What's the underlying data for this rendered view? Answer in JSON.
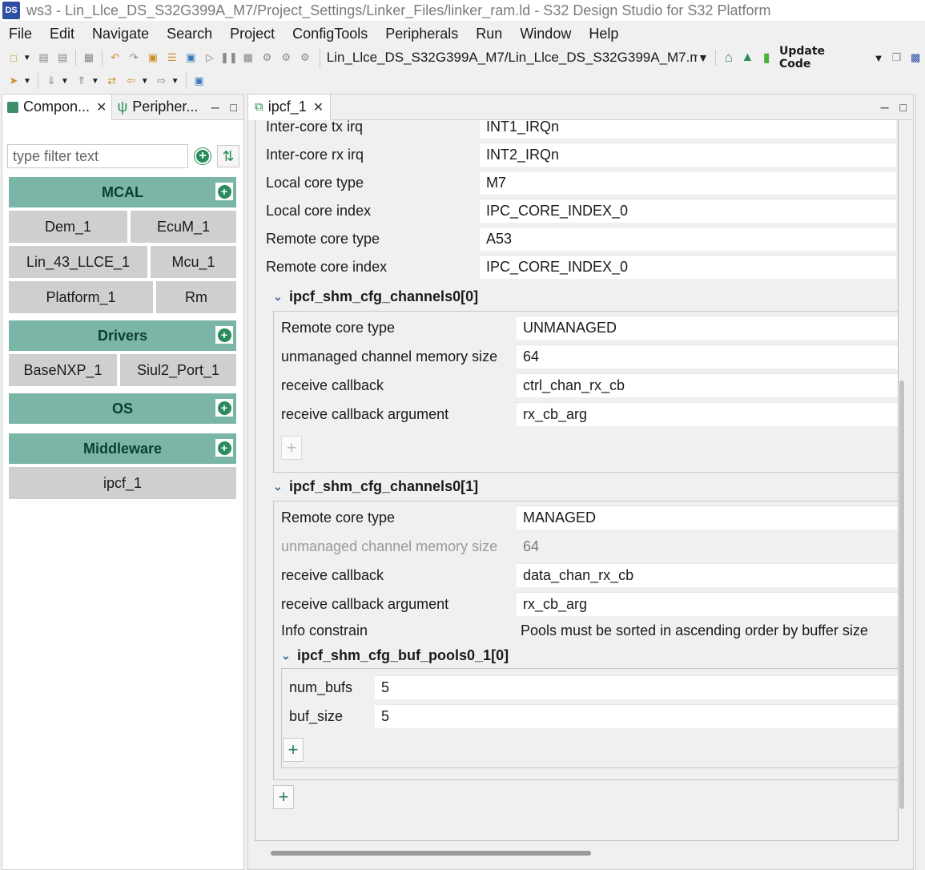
{
  "window": {
    "title": "ws3 - Lin_Llce_DS_S32G399A_M7/Project_Settings/Linker_Files/linker_ram.ld - S32 Design Studio for S32 Platform"
  },
  "menu": [
    "File",
    "Edit",
    "Navigate",
    "Search",
    "Project",
    "ConfigTools",
    "Peripherals",
    "Run",
    "Window",
    "Help"
  ],
  "toolbar": {
    "path": "Lin_Llce_DS_S32G399A_M7/Lin_Llce_DS_S32G399A_M7.m",
    "update_code": "Update Code"
  },
  "left": {
    "tab1": "Compon...",
    "tab2": "Peripher...",
    "filter_placeholder": "type filter text",
    "categories": {
      "mcal": {
        "name": "MCAL",
        "items": [
          "Dem_1",
          "EcuM_1",
          "Lin_43_LLCE_1",
          "Mcu_1",
          "Platform_1",
          "Rm"
        ]
      },
      "drivers": {
        "name": "Drivers",
        "items": [
          "BaseNXP_1",
          "Siul2_Port_1"
        ]
      },
      "os": {
        "name": "OS"
      },
      "middleware": {
        "name": "Middleware",
        "items": [
          "ipcf_1"
        ]
      }
    }
  },
  "editor": {
    "tab": "ipcf_1",
    "top_rows": [
      {
        "label": "Inter-core tx irq",
        "value": "INT1_IRQn"
      },
      {
        "label": "Inter-core rx irq",
        "value": "INT2_IRQn"
      },
      {
        "label": "Local core type",
        "value": "M7"
      },
      {
        "label": "Local core index",
        "value": "IPC_CORE_INDEX_0"
      },
      {
        "label": "Remote core type",
        "value": "A53"
      },
      {
        "label": "Remote core index",
        "value": "IPC_CORE_INDEX_0"
      }
    ],
    "ch0": {
      "title": "ipcf_shm_cfg_channels0[0]",
      "rows": [
        {
          "label": "Remote core type",
          "value": "UNMANAGED"
        },
        {
          "label": "unmanaged channel memory size",
          "value": "64"
        },
        {
          "label": "receive callback",
          "value": "ctrl_chan_rx_cb"
        },
        {
          "label": "receive callback argument",
          "value": "rx_cb_arg"
        }
      ]
    },
    "ch1": {
      "title": "ipcf_shm_cfg_channels0[1]",
      "rows": [
        {
          "label": "Remote core type",
          "value": "MANAGED"
        },
        {
          "label": "unmanaged channel memory size",
          "value": "64"
        },
        {
          "label": "receive callback",
          "value": "data_chan_rx_cb"
        },
        {
          "label": "receive callback argument",
          "value": "rx_cb_arg"
        }
      ],
      "info_label": "Info constrain",
      "info_value": "Pools must be sorted in ascending order by buffer size"
    },
    "pool": {
      "title": "ipcf_shm_cfg_buf_pools0_1[0]",
      "rows": [
        {
          "label": "num_bufs",
          "value": "5"
        },
        {
          "label": "buf_size",
          "value": "5"
        }
      ]
    },
    "plus": "+"
  }
}
